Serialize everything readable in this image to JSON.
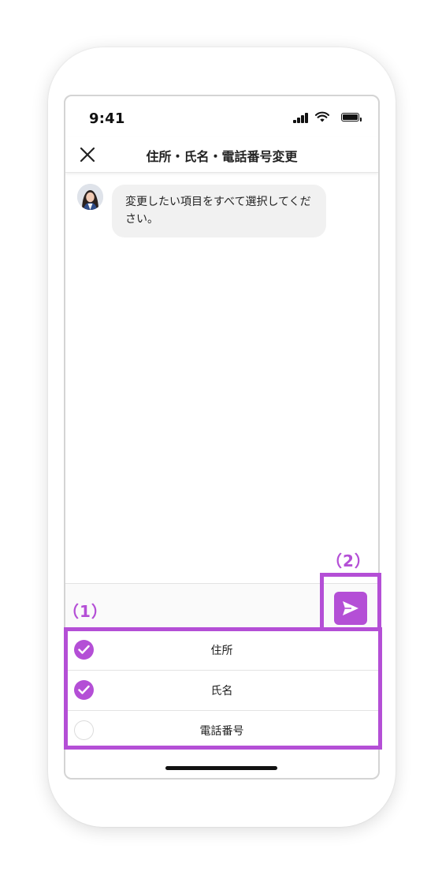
{
  "status_bar": {
    "time": "9:41"
  },
  "nav": {
    "title": "住所・氏名・電話番号変更"
  },
  "chat": {
    "messages": [
      {
        "text": "変更したい項目をすべて選択してください。"
      }
    ]
  },
  "options": [
    {
      "label": "住所",
      "selected": true
    },
    {
      "label": "氏名",
      "selected": true
    },
    {
      "label": "電話番号",
      "selected": false
    }
  ],
  "annotations": {
    "options_label": "（1）",
    "send_label": "（2）"
  },
  "icons": {
    "close": "close-icon",
    "send": "send-icon",
    "check": "checkmark-icon",
    "signal": "cellular-signal-icon",
    "wifi": "wifi-icon",
    "battery": "battery-icon"
  },
  "colors": {
    "accent": "#b44fd6",
    "bubble": "#f1f1f1",
    "text": "#222222"
  }
}
